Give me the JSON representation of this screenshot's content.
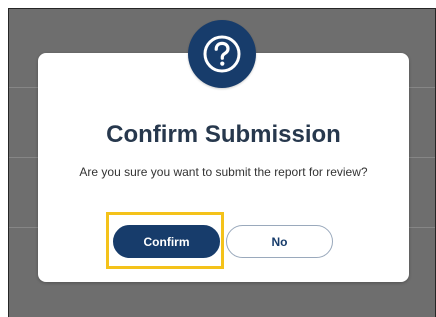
{
  "dialog": {
    "icon": "question-circle-icon",
    "title": "Confirm Submission",
    "message": "Are you sure you want to submit the report for review?",
    "confirm_label": "Confirm",
    "cancel_label": "No"
  },
  "colors": {
    "primary": "#173c6b",
    "title_text": "#27384d",
    "focus_outline": "#f4c21a",
    "overlay": "#6e6e6e"
  }
}
